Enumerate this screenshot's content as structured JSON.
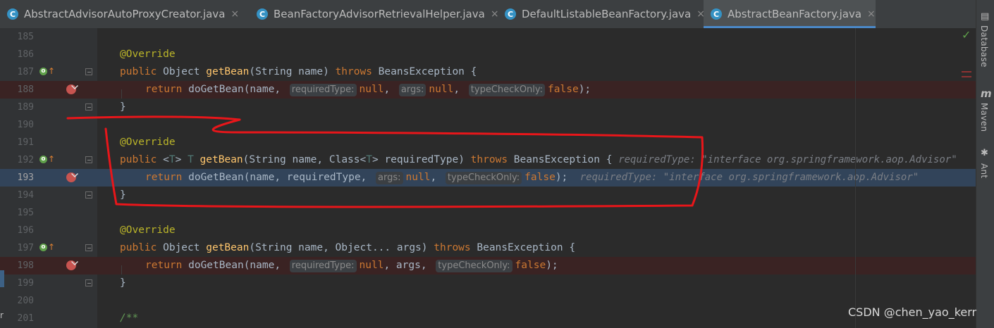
{
  "tabs": [
    {
      "label": "AbstractAdvisorAutoProxyCreator.java",
      "active": false
    },
    {
      "label": "BeanFactoryAdvisorRetrievalHelper.java",
      "active": false
    },
    {
      "label": "DefaultListableBeanFactory.java",
      "active": false
    },
    {
      "label": "AbstractBeanFactory.java",
      "active": true
    }
  ],
  "tab_icon_letter": "C",
  "tab_close": "×",
  "lines": {
    "l185": "185",
    "l186": "186",
    "l187": "187",
    "l188": "188",
    "l189": "189",
    "l190": "190",
    "l191": "191",
    "l192": "192",
    "l193": "193",
    "l194": "194",
    "l195": "195",
    "l196": "196",
    "l197": "197",
    "l198": "198",
    "l199": "199",
    "l200": "200",
    "l201": "201"
  },
  "code": {
    "override": "@Override",
    "public": "public",
    "object": " Object ",
    "getBean": "getBean",
    "sig1": "(String name) ",
    "throws": "throws",
    "exc": " BeansException {",
    "ret": "return",
    "doGetBean": " doGetBean(name, ",
    "hint_requiredType": "requiredType:",
    "hint_args": "args:",
    "hint_typeCheckOnly": "typeCheckOnly:",
    "null": "null",
    "comma": ", ",
    "false": "false",
    "end": ");",
    "close": "}",
    "generic_open": " <",
    "T": "T",
    "generic_close": "> ",
    "T2": "T ",
    "sig2a": "(String name, Class<",
    "sig2b": "> requiredType) ",
    "exc2": " BeansException { ",
    "inline192": "requiredType: \"interface org.springframework.aop.Advisor\"",
    "ret193_args": " doGetBean(name, requiredType, ",
    "inline193": "requiredType: \"interface org.springframework.aop.Advisor\"",
    "sig3": "(String name, Object... args) ",
    "args_word": "args, ",
    "doc": "/**"
  },
  "right_tools": {
    "database": "Database",
    "maven": "Maven",
    "maven_icon": "m",
    "ant": "Ant",
    "check_icon": "✓"
  },
  "watermark": "CSDN @chen_yao_kerr",
  "left_edge": "r"
}
